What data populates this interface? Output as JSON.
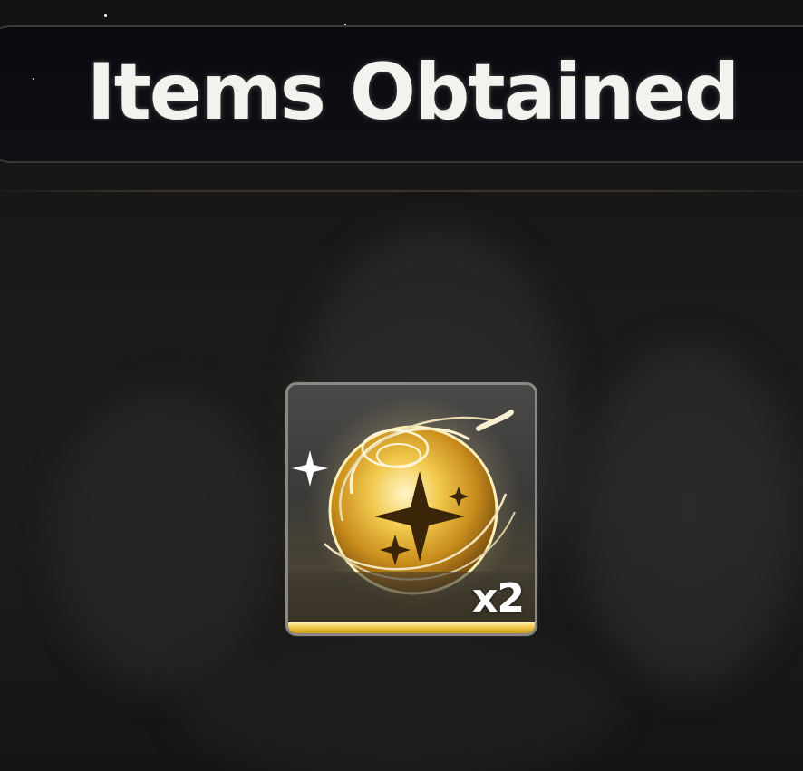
{
  "header": {
    "title": "Items Obtained"
  },
  "items": [
    {
      "icon": "golden-sparkle-orb-icon",
      "quantity": "x2",
      "rarity_color": "#f2c84a"
    }
  ],
  "colors": {
    "title_text": "#f4f2ee",
    "header_border": "#786e5c",
    "card_border": "#8a8884",
    "rarity_gold": "#f2c84a"
  }
}
